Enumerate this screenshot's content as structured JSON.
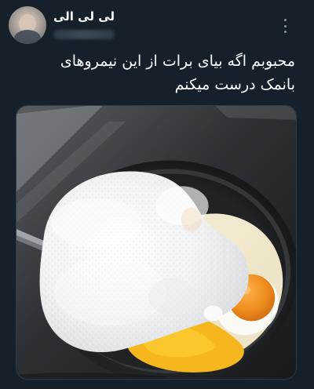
{
  "tweet": {
    "display_name": "لی لی الی",
    "text": "محبوبم اگه بیای برات از این نیمروهای بانمک درست میکنم"
  },
  "icons": {
    "more": "more-icon"
  },
  "colors": {
    "background": "#15202b",
    "text": "#ffffff",
    "muted": "#8899a6"
  }
}
